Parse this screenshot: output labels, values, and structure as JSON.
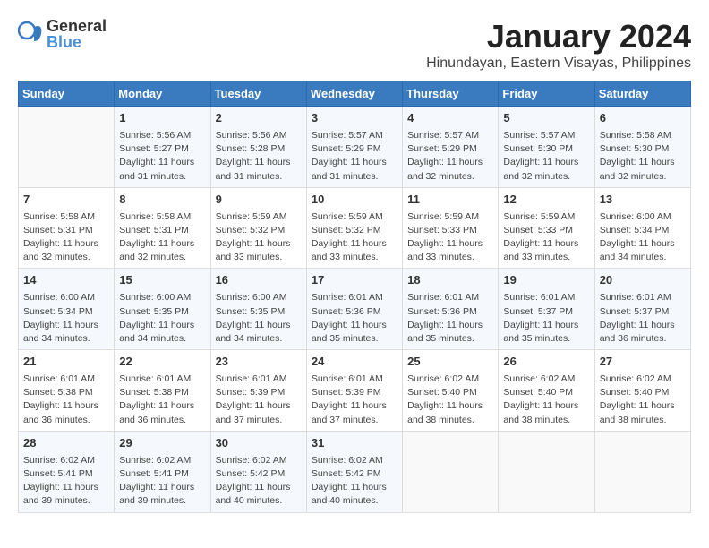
{
  "logo": {
    "general": "General",
    "blue": "Blue"
  },
  "title": "January 2024",
  "subtitle": "Hinundayan, Eastern Visayas, Philippines",
  "days_of_week": [
    "Sunday",
    "Monday",
    "Tuesday",
    "Wednesday",
    "Thursday",
    "Friday",
    "Saturday"
  ],
  "weeks": [
    [
      {
        "day": "",
        "info": ""
      },
      {
        "day": "1",
        "info": "Sunrise: 5:56 AM\nSunset: 5:27 PM\nDaylight: 11 hours\nand 31 minutes."
      },
      {
        "day": "2",
        "info": "Sunrise: 5:56 AM\nSunset: 5:28 PM\nDaylight: 11 hours\nand 31 minutes."
      },
      {
        "day": "3",
        "info": "Sunrise: 5:57 AM\nSunset: 5:29 PM\nDaylight: 11 hours\nand 31 minutes."
      },
      {
        "day": "4",
        "info": "Sunrise: 5:57 AM\nSunset: 5:29 PM\nDaylight: 11 hours\nand 32 minutes."
      },
      {
        "day": "5",
        "info": "Sunrise: 5:57 AM\nSunset: 5:30 PM\nDaylight: 11 hours\nand 32 minutes."
      },
      {
        "day": "6",
        "info": "Sunrise: 5:58 AM\nSunset: 5:30 PM\nDaylight: 11 hours\nand 32 minutes."
      }
    ],
    [
      {
        "day": "7",
        "info": "Sunrise: 5:58 AM\nSunset: 5:31 PM\nDaylight: 11 hours\nand 32 minutes."
      },
      {
        "day": "8",
        "info": "Sunrise: 5:58 AM\nSunset: 5:31 PM\nDaylight: 11 hours\nand 32 minutes."
      },
      {
        "day": "9",
        "info": "Sunrise: 5:59 AM\nSunset: 5:32 PM\nDaylight: 11 hours\nand 33 minutes."
      },
      {
        "day": "10",
        "info": "Sunrise: 5:59 AM\nSunset: 5:32 PM\nDaylight: 11 hours\nand 33 minutes."
      },
      {
        "day": "11",
        "info": "Sunrise: 5:59 AM\nSunset: 5:33 PM\nDaylight: 11 hours\nand 33 minutes."
      },
      {
        "day": "12",
        "info": "Sunrise: 5:59 AM\nSunset: 5:33 PM\nDaylight: 11 hours\nand 33 minutes."
      },
      {
        "day": "13",
        "info": "Sunrise: 6:00 AM\nSunset: 5:34 PM\nDaylight: 11 hours\nand 34 minutes."
      }
    ],
    [
      {
        "day": "14",
        "info": "Sunrise: 6:00 AM\nSunset: 5:34 PM\nDaylight: 11 hours\nand 34 minutes."
      },
      {
        "day": "15",
        "info": "Sunrise: 6:00 AM\nSunset: 5:35 PM\nDaylight: 11 hours\nand 34 minutes."
      },
      {
        "day": "16",
        "info": "Sunrise: 6:00 AM\nSunset: 5:35 PM\nDaylight: 11 hours\nand 34 minutes."
      },
      {
        "day": "17",
        "info": "Sunrise: 6:01 AM\nSunset: 5:36 PM\nDaylight: 11 hours\nand 35 minutes."
      },
      {
        "day": "18",
        "info": "Sunrise: 6:01 AM\nSunset: 5:36 PM\nDaylight: 11 hours\nand 35 minutes."
      },
      {
        "day": "19",
        "info": "Sunrise: 6:01 AM\nSunset: 5:37 PM\nDaylight: 11 hours\nand 35 minutes."
      },
      {
        "day": "20",
        "info": "Sunrise: 6:01 AM\nSunset: 5:37 PM\nDaylight: 11 hours\nand 36 minutes."
      }
    ],
    [
      {
        "day": "21",
        "info": "Sunrise: 6:01 AM\nSunset: 5:38 PM\nDaylight: 11 hours\nand 36 minutes."
      },
      {
        "day": "22",
        "info": "Sunrise: 6:01 AM\nSunset: 5:38 PM\nDaylight: 11 hours\nand 36 minutes."
      },
      {
        "day": "23",
        "info": "Sunrise: 6:01 AM\nSunset: 5:39 PM\nDaylight: 11 hours\nand 37 minutes."
      },
      {
        "day": "24",
        "info": "Sunrise: 6:01 AM\nSunset: 5:39 PM\nDaylight: 11 hours\nand 37 minutes."
      },
      {
        "day": "25",
        "info": "Sunrise: 6:02 AM\nSunset: 5:40 PM\nDaylight: 11 hours\nand 38 minutes."
      },
      {
        "day": "26",
        "info": "Sunrise: 6:02 AM\nSunset: 5:40 PM\nDaylight: 11 hours\nand 38 minutes."
      },
      {
        "day": "27",
        "info": "Sunrise: 6:02 AM\nSunset: 5:40 PM\nDaylight: 11 hours\nand 38 minutes."
      }
    ],
    [
      {
        "day": "28",
        "info": "Sunrise: 6:02 AM\nSunset: 5:41 PM\nDaylight: 11 hours\nand 39 minutes."
      },
      {
        "day": "29",
        "info": "Sunrise: 6:02 AM\nSunset: 5:41 PM\nDaylight: 11 hours\nand 39 minutes."
      },
      {
        "day": "30",
        "info": "Sunrise: 6:02 AM\nSunset: 5:42 PM\nDaylight: 11 hours\nand 40 minutes."
      },
      {
        "day": "31",
        "info": "Sunrise: 6:02 AM\nSunset: 5:42 PM\nDaylight: 11 hours\nand 40 minutes."
      },
      {
        "day": "",
        "info": ""
      },
      {
        "day": "",
        "info": ""
      },
      {
        "day": "",
        "info": ""
      }
    ]
  ]
}
